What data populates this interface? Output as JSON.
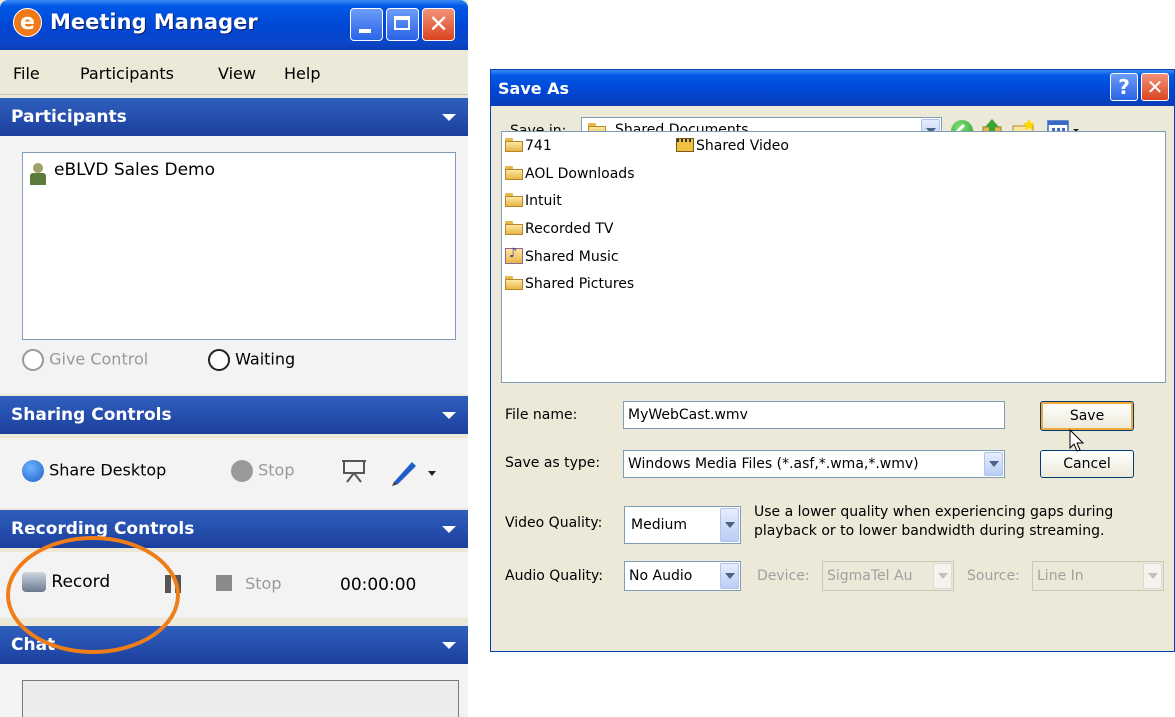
{
  "meeting_manager": {
    "title": "Meeting Manager",
    "menu": [
      "File",
      "Participants",
      "View",
      "Help"
    ],
    "participants_header": "Participants",
    "participants": [
      {
        "name": "eBLVD Sales Demo",
        "icon": "person-icon"
      }
    ],
    "give_control_label": "Give Control",
    "waiting_label": "Waiting",
    "sharing_header": "Sharing Controls",
    "share_desktop_label": "Share Desktop",
    "sharing_stop_label": "Stop",
    "recording_header": "Recording Controls",
    "record_label": "Record",
    "recording_stop_label": "Stop",
    "timer": "00:00:00",
    "chat_header": "Chat",
    "highlight_color": "#f07e18"
  },
  "save_as": {
    "title": "Save As",
    "save_in_label": "Save in:",
    "save_in_value": "Shared Documents",
    "files_col1": [
      {
        "name": "741",
        "icon": "folder-icon"
      },
      {
        "name": "AOL Downloads",
        "icon": "folder-icon"
      },
      {
        "name": "Intuit",
        "icon": "folder-icon"
      },
      {
        "name": "Recorded TV",
        "icon": "folder-icon"
      },
      {
        "name": "Shared Music",
        "icon": "music-folder-icon"
      },
      {
        "name": "Shared Pictures",
        "icon": "folder-icon"
      }
    ],
    "files_col2": [
      {
        "name": "Shared Video",
        "icon": "video-folder-icon"
      }
    ],
    "file_name_label": "File name:",
    "file_name_value": "MyWebCast.wmv",
    "save_type_label": "Save as type:",
    "save_type_value": "Windows Media Files (*.asf,*.wma,*.wmv)",
    "save_button": "Save",
    "cancel_button": "Cancel",
    "video_quality_label": "Video Quality:",
    "video_quality_value": "Medium",
    "video_quality_hint": "Use a lower quality when experiencing gaps during playback or to lower bandwidth during streaming.",
    "audio_quality_label": "Audio Quality:",
    "audio_quality_value": "No Audio",
    "device_label": "Device:",
    "device_value": "SigmaTel Au",
    "source_label": "Source:",
    "source_value": "Line In"
  }
}
